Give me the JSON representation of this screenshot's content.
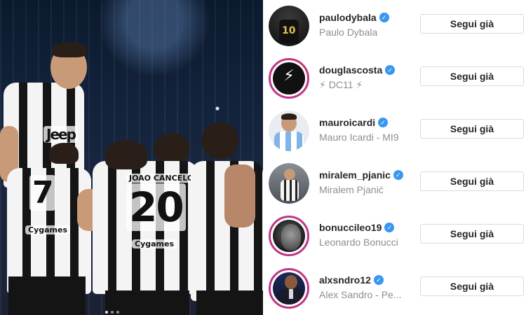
{
  "photo": {
    "jersey_numbers": [
      "7",
      "20"
    ],
    "jersey_name": "JOAO CANCELO",
    "sponsor": "Jeep",
    "sleeve_sponsor": "Cygames",
    "carousel_dots": 3
  },
  "accounts": [
    {
      "username": "paulodybala",
      "full_name": "Paulo Dybala",
      "follow_label": "Segui già",
      "story_ring": false,
      "avatar_icon": "jersey-10-avatar"
    },
    {
      "username": "douglascosta",
      "full_name": "⚡ DC11 ⚡",
      "follow_label": "Segui già",
      "story_ring": true,
      "avatar_icon": "lightning-logo-avatar"
    },
    {
      "username": "mauroicardi",
      "full_name": "Mauro Icardi - MI9",
      "follow_label": "Segui già",
      "story_ring": false,
      "avatar_icon": "argentina-jersey-avatar"
    },
    {
      "username": "miralem_pjanic",
      "full_name": "Miralem Pjanić",
      "follow_label": "Segui già",
      "story_ring": false,
      "avatar_icon": "player-photo-avatar"
    },
    {
      "username": "bonucci leo19",
      "full_name": "Leonardo Bonucci",
      "follow_label": "Segui già",
      "story_ring": true,
      "avatar_icon": "face-portrait-avatar"
    },
    {
      "username": "alxsndro12",
      "full_name": "Alex Sandro - Pe...",
      "follow_label": "Segui già",
      "story_ring": true,
      "avatar_icon": "suit-portrait-avatar"
    }
  ],
  "colors": {
    "verified": "#3897f0",
    "story_ring": "#c13584",
    "text": "#262626",
    "muted": "#8e8e8e"
  }
}
